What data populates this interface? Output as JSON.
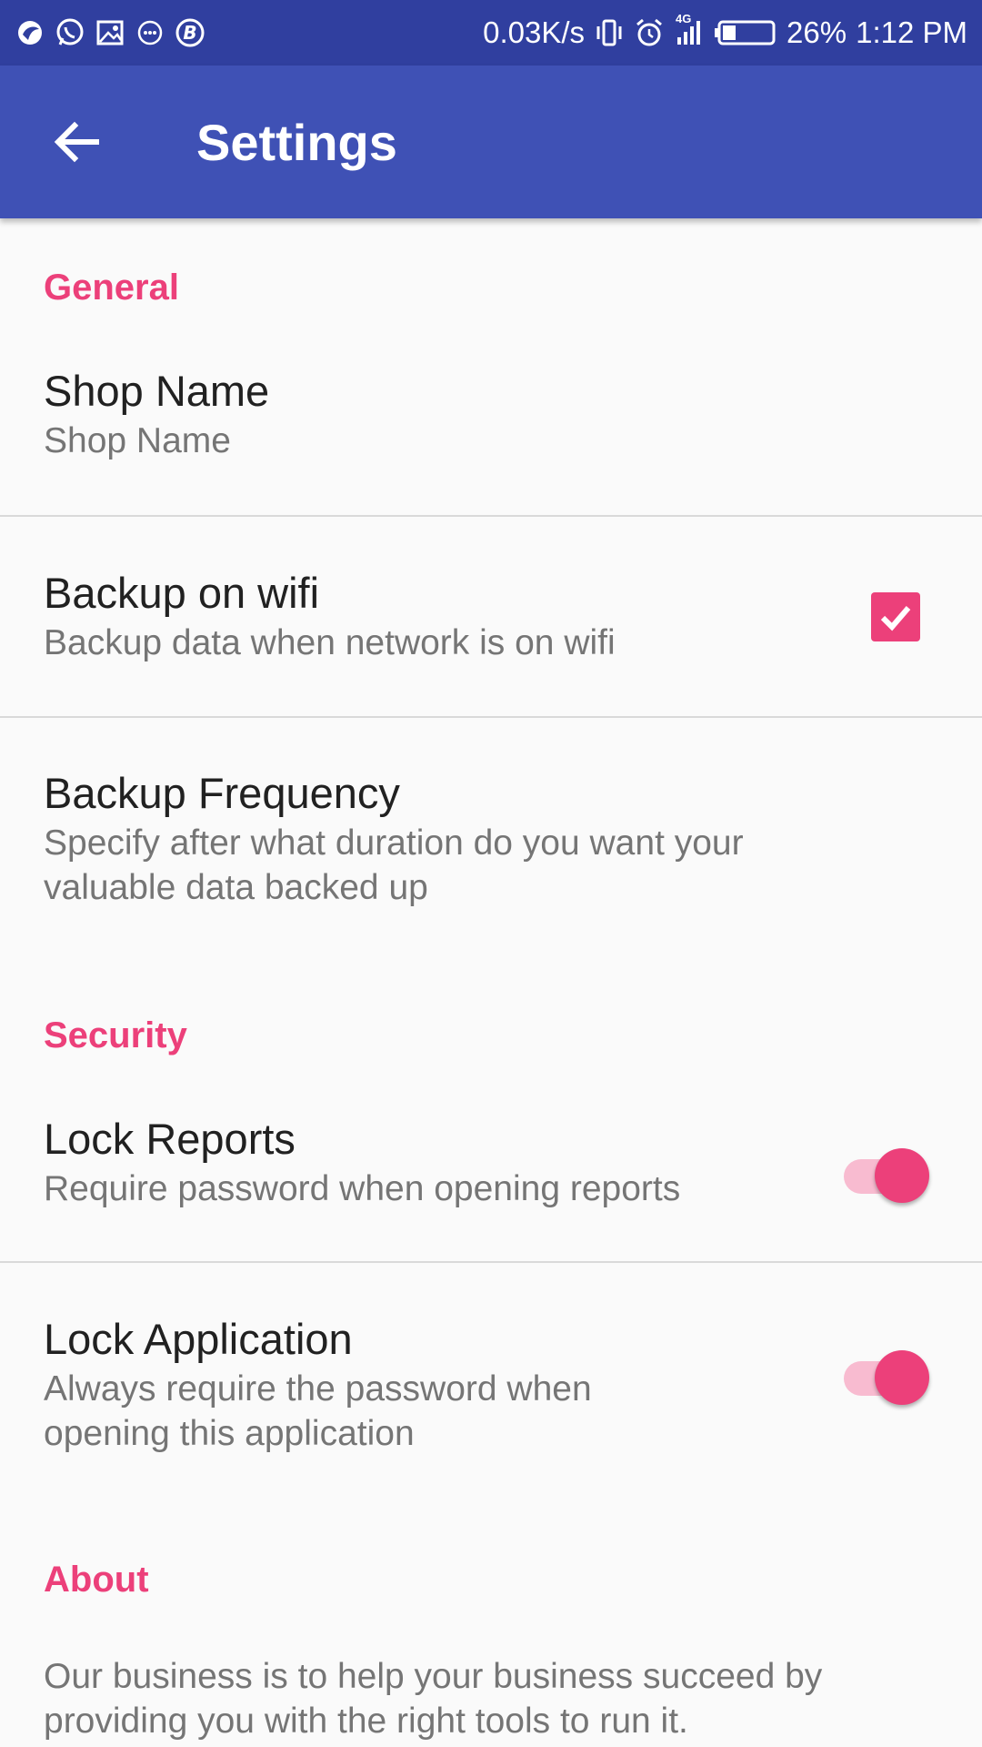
{
  "status_bar": {
    "icons_left": [
      "bird-icon",
      "whatsapp-icon",
      "gallery-icon",
      "messenger-icon",
      "b-icon"
    ],
    "net_speed": "0.03K/s",
    "network_type": "4G",
    "battery": "26%",
    "time": "1:12 PM"
  },
  "app_bar": {
    "title": "Settings",
    "back_icon": "arrow-back-icon",
    "color": "#3f51b5"
  },
  "accent_color": "#ec407a",
  "sections": {
    "general": {
      "header": "General",
      "shop_name": {
        "title": "Shop Name",
        "summary": "Shop Name"
      },
      "backup_wifi": {
        "title": "Backup on wifi",
        "summary": "Backup data when network is on wifi",
        "checked": true
      },
      "backup_frequency": {
        "title": "Backup Frequency",
        "summary": "Specify after what duration do you want your valuable data backed up"
      }
    },
    "security": {
      "header": "Security",
      "lock_reports": {
        "title": "Lock Reports",
        "summary": "Require password when opening reports",
        "enabled": true
      },
      "lock_application": {
        "title": "Lock Application",
        "summary": "Always require the password when opening this application",
        "enabled": true
      }
    },
    "about": {
      "header": "About",
      "text": "Our business is to help your business succeed by providing you with the right tools to run it."
    }
  }
}
